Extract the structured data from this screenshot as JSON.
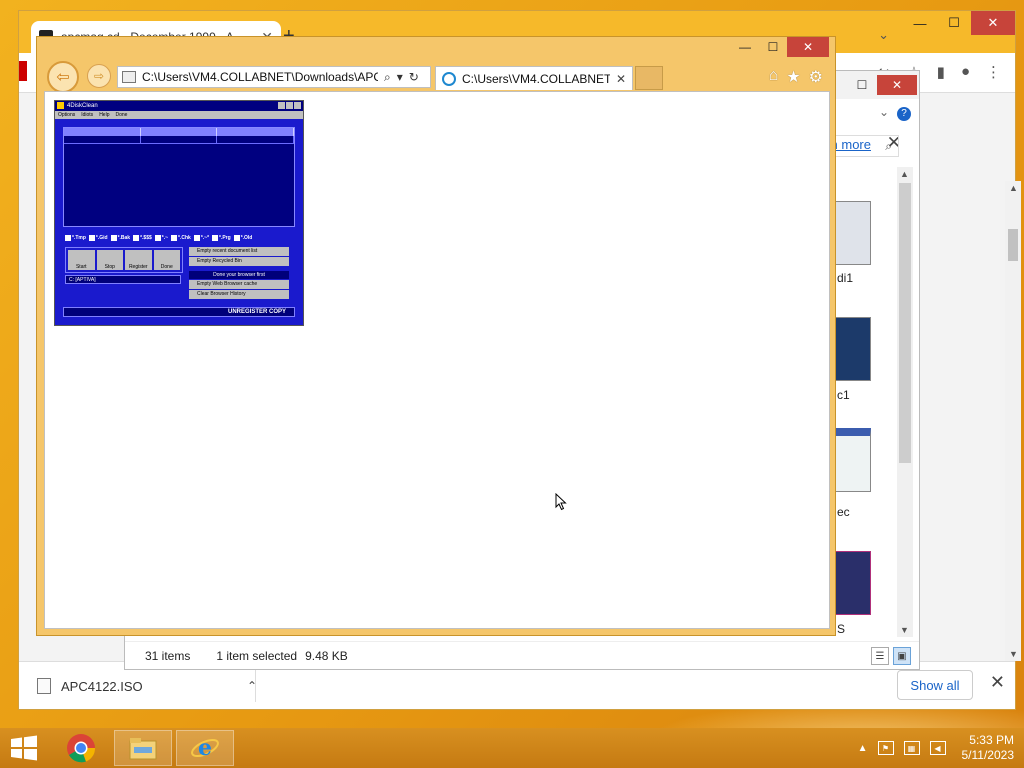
{
  "chrome": {
    "tab_title": "apcmag.cd - December 1999 - A",
    "download": {
      "filename": "APC4122.ISO",
      "show_all": "Show all"
    }
  },
  "explorer": {
    "learn_more": "n more",
    "thumb_labels": [
      "di1",
      "c1",
      "ec",
      "S"
    ],
    "status": {
      "items": "31 items",
      "selected": "1 item selected",
      "size": "9.48 KB"
    }
  },
  "ie": {
    "address": "C:\\Users\\VM4.COLLABNET\\Downloads\\APC",
    "tab_title": "C:\\Users\\VM4.COLLABNET..."
  },
  "screenshot_app": {
    "title": "4DiskClean",
    "menu": [
      "Options",
      "Idiots",
      "Help",
      "Done"
    ],
    "checks": [
      "*.Tmp",
      "*.Gid",
      "*.Bak",
      "*.$$$",
      "*.~",
      "*.Chk",
      "*.~*",
      "*.Prg",
      "*.Old"
    ],
    "tools": [
      "Start",
      "Stop",
      "Register",
      "Done"
    ],
    "drive": "C: [APTIVA]",
    "right_buttons": [
      "Empty recent document list",
      "Empty Recycled Bin"
    ],
    "browser_header": "Done your browser first",
    "browser_buttons": [
      "Empty Web Browser cache",
      "Clear Browser History"
    ],
    "status": "UNREGISTER COPY"
  },
  "taskbar": {
    "time": "5:33 PM",
    "date": "5/11/2023"
  }
}
